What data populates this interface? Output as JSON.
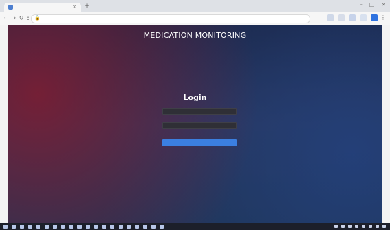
{
  "app": {
    "heading": "MEDICATION MONITORING",
    "login_title": "Login"
  },
  "browser": {
    "tab_title": "",
    "url": ""
  },
  "form": {
    "username_placeholder": "",
    "password_placeholder": "",
    "submit_label": ""
  },
  "colors": {
    "accent": "#3b7fe0",
    "page_left": "#821c30",
    "page_right": "#23417d",
    "taskbar": "#1c1f2a"
  },
  "icons": {
    "tab_favicon": "page-favicon-icon",
    "back": "arrow-left-icon",
    "forward": "arrow-right-icon",
    "reload": "reload-icon",
    "home": "home-icon",
    "lock": "lock-icon",
    "menu": "more-vertical-icon"
  }
}
